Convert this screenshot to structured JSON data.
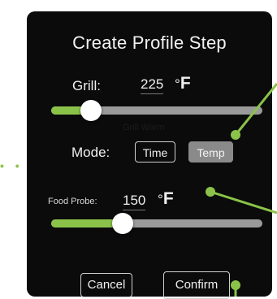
{
  "dialog": {
    "title": "Create Profile Step",
    "grill": {
      "label": "Grill:",
      "value": "225",
      "unit_degree": "°",
      "unit_letter": "F",
      "slider_fraction": 0.19
    },
    "ghost_text": "Grill Warm",
    "mode": {
      "label": "Mode:",
      "options": [
        "Time",
        "Temp"
      ],
      "selected": "Temp"
    },
    "probe": {
      "label": "Food Probe:",
      "value": "150",
      "unit_degree": "°",
      "unit_letter": "F",
      "slider_fraction": 0.34
    },
    "buttons": {
      "cancel": "Cancel",
      "confirm": "Confirm"
    }
  },
  "colors": {
    "accent_green": "#8bc34a",
    "panel": "#0b0b0b",
    "track": "#9a9a9a",
    "selected_button": "#8a8a8a"
  },
  "decorations": {
    "left_dots": "• • •"
  }
}
